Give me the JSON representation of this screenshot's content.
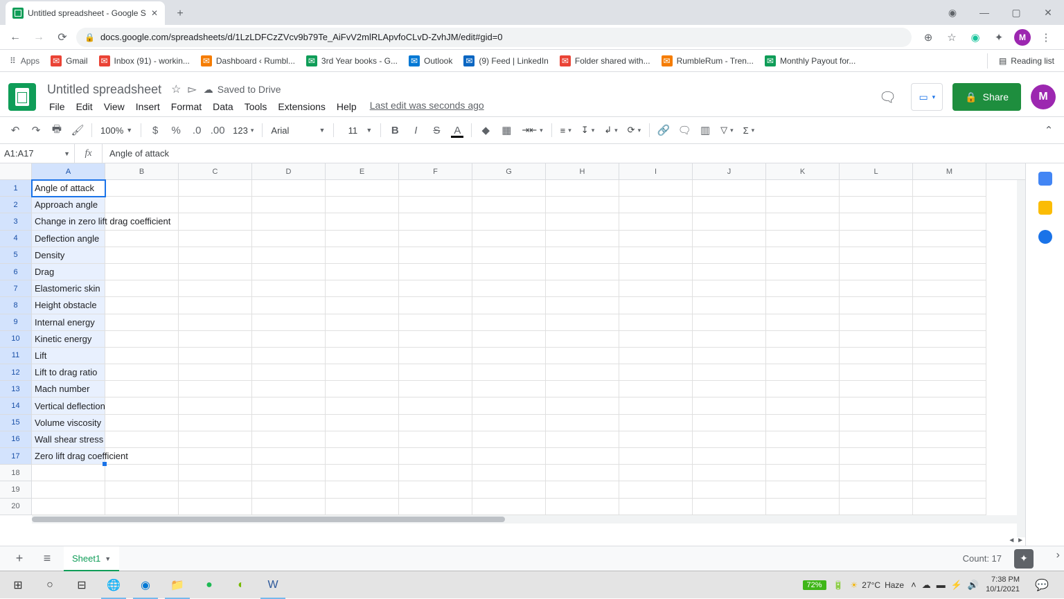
{
  "browser": {
    "tab_title": "Untitled spreadsheet - Google S",
    "url": "docs.google.com/spreadsheets/d/1LzLDFCzZVcv9b79Te_AiFvV2mlRLApvfoCLvD-ZvhJM/edit#gid=0",
    "avatar_letter": "M"
  },
  "bookmarks": {
    "apps": "Apps",
    "items": [
      {
        "label": "Gmail",
        "color": "#ea4335"
      },
      {
        "label": "Inbox (91) - workin...",
        "color": "#ea4335"
      },
      {
        "label": "Dashboard ‹ Rumbl...",
        "color": "#f57c00"
      },
      {
        "label": "3rd Year books - G...",
        "color": "#0f9d58"
      },
      {
        "label": "Outlook",
        "color": "#0078d4"
      },
      {
        "label": "(9) Feed | LinkedIn",
        "color": "#0a66c2"
      },
      {
        "label": "Folder shared with...",
        "color": "#ea4335"
      },
      {
        "label": "RumbleRum - Tren...",
        "color": "#f57c00"
      },
      {
        "label": "Monthly Payout for...",
        "color": "#0f9d58"
      }
    ],
    "reading_list": "Reading list"
  },
  "sheets": {
    "title": "Untitled spreadsheet",
    "saved": "Saved to Drive",
    "menus": [
      "File",
      "Edit",
      "View",
      "Insert",
      "Format",
      "Data",
      "Tools",
      "Extensions",
      "Help"
    ],
    "last_edit": "Last edit was seconds ago",
    "share": "Share",
    "avatar_letter": "M"
  },
  "toolbar": {
    "zoom": "100%",
    "numfmt": "123",
    "font": "Arial",
    "fontsize": "11"
  },
  "namebox": "A1:A17",
  "formula": "Angle of attack",
  "columns": [
    "A",
    "B",
    "C",
    "D",
    "E",
    "F",
    "G",
    "H",
    "I",
    "J",
    "K",
    "L",
    "M"
  ],
  "rows": [
    {
      "n": "1",
      "a": "Angle of attack"
    },
    {
      "n": "2",
      "a": "Approach angle"
    },
    {
      "n": "3",
      "a": "Change in zero lift drag coefficient"
    },
    {
      "n": "4",
      "a": "Deflection angle"
    },
    {
      "n": "5",
      "a": "Density"
    },
    {
      "n": "6",
      "a": "Drag"
    },
    {
      "n": "7",
      "a": "Elastomeric skin"
    },
    {
      "n": "8",
      "a": "Height obstacle"
    },
    {
      "n": "9",
      "a": "Internal energy"
    },
    {
      "n": "10",
      "a": "Kinetic energy"
    },
    {
      "n": "11",
      "a": "Lift"
    },
    {
      "n": "12",
      "a": "Lift to drag ratio"
    },
    {
      "n": "13",
      "a": "Mach number"
    },
    {
      "n": "14",
      "a": "Vertical deflection"
    },
    {
      "n": "15",
      "a": "Volume viscosity"
    },
    {
      "n": "16",
      "a": "Wall shear stress"
    },
    {
      "n": "17",
      "a": "Zero lift drag coefficient"
    },
    {
      "n": "18",
      "a": ""
    },
    {
      "n": "19",
      "a": ""
    },
    {
      "n": "20",
      "a": ""
    }
  ],
  "sheet_tab": "Sheet1",
  "count": "Count: 17",
  "taskbar": {
    "battery": "72%",
    "temp": "27°C",
    "weather": "Haze",
    "time": "7:38 PM",
    "date": "10/1/2021"
  }
}
